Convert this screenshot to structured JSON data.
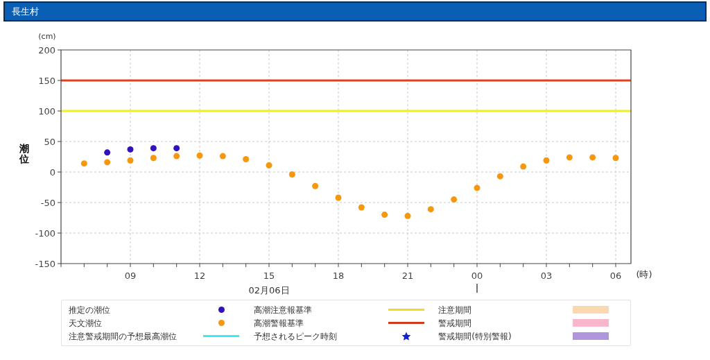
{
  "header": {
    "title": "長生村"
  },
  "chart": {
    "unit_y": "(cm)",
    "unit_x": "(時)",
    "date_label": "02月06日",
    "chart_data": {
      "type": "scatter",
      "ylabel": "潮位",
      "ylim": [
        -150,
        200
      ],
      "grid": true,
      "yticks": [
        -150,
        -100,
        -50,
        0,
        50,
        100,
        150,
        200
      ],
      "categories": [
        null,
        null,
        "09",
        null,
        null,
        "12",
        null,
        null,
        "15",
        null,
        null,
        "18",
        null,
        null,
        "21",
        null,
        null,
        "00",
        null,
        null,
        "03",
        null,
        null,
        "06"
      ],
      "series": [
        {
          "color": "#3311bb",
          "values": [
            null,
            32,
            37,
            39,
            39,
            null,
            null,
            null,
            null,
            null,
            null,
            null,
            null,
            null,
            null,
            null,
            null,
            null,
            null,
            null,
            null,
            null,
            null,
            null
          ]
        },
        {
          "color": "#f5980f",
          "values": [
            14,
            16,
            19,
            23,
            26,
            27,
            26,
            21,
            11,
            -4,
            -23,
            -42,
            -58,
            -70,
            -72,
            -61,
            -45,
            -26,
            -7,
            9,
            19,
            24,
            24,
            23
          ]
        }
      ],
      "ref_lines": [
        {
          "axis": "y",
          "value": 150,
          "color": "#e8401c"
        },
        {
          "axis": "y",
          "value": 100,
          "color": "#eeee22"
        }
      ]
    }
  },
  "legend": [
    {
      "label": "推定の潮位",
      "kind": "dot",
      "color": "#3311bb"
    },
    {
      "label": "高潮注意報基準",
      "kind": "line",
      "color": "#eedd22"
    },
    {
      "label": "注意期間",
      "kind": "band",
      "color": "#fad9b0"
    },
    {
      "label": "天文潮位",
      "kind": "dot",
      "color": "#f5980f"
    },
    {
      "label": "高潮警報基準",
      "kind": "line",
      "color": "#d23a1c"
    },
    {
      "label": "警戒期間",
      "kind": "band",
      "color": "#f9b6cc"
    },
    {
      "label": "注意警戒期間の予想最高潮位",
      "kind": "line",
      "color": "#33eeee"
    },
    {
      "label": "予想されるピーク時刻",
      "kind": "star",
      "color": "#1122cc"
    },
    {
      "label": "警戒期間(特別警報)",
      "kind": "band",
      "color": "#b096dc"
    }
  ]
}
